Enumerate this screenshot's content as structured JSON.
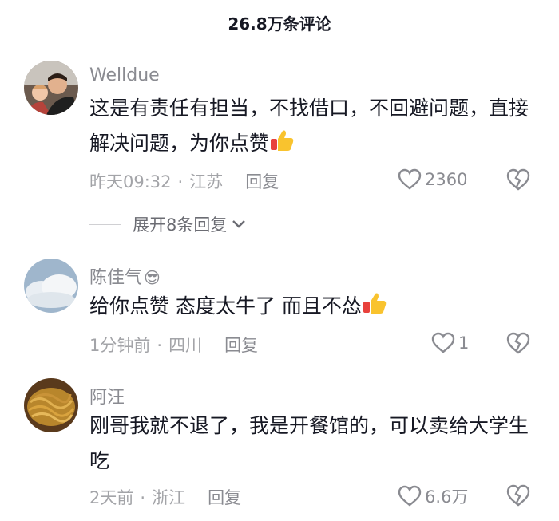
{
  "header": {
    "title": "26.8万条评论"
  },
  "comments": [
    {
      "username": "Welldue",
      "text": "这是有责任有担当，不找借口，不回避问题，直接解决问题，为你点赞",
      "time": "昨天09:32",
      "location": "江苏",
      "reply_label": "回复",
      "likes": "2360",
      "icons": [
        "heart-icon",
        "broken-heart-icon",
        "thumbs-up-emoji"
      ]
    },
    {
      "username": "陈佳气",
      "username_emoji": "😎",
      "text": "给你点赞 态度太牛了 而且不怂",
      "time": "1分钟前",
      "location": "四川",
      "reply_label": "回复",
      "likes": "1"
    },
    {
      "username": "阿汪",
      "text": "刚哥我就不退了，我是开餐馆的，可以卖给大学生吃",
      "time": "2天前",
      "location": "浙江",
      "reply_label": "回复",
      "likes": "6.6万"
    }
  ],
  "expand_replies": {
    "label": "展开8条回复"
  },
  "separator": "·",
  "colors": {
    "text": "#161823",
    "secondary": "#8a8b91",
    "muted": "#a3a4a8"
  }
}
